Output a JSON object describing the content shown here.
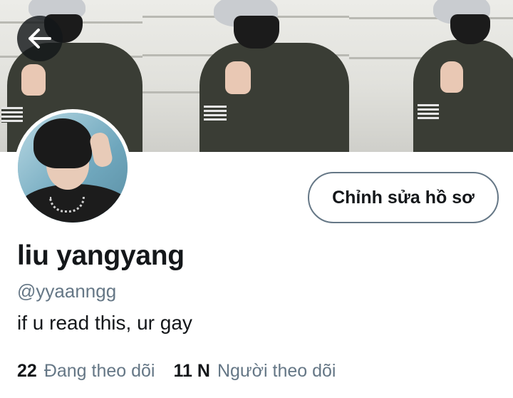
{
  "profile": {
    "display_name": "liu yangyang",
    "handle": "@yyaanngg",
    "bio": "if u read this, ur gay",
    "edit_button_label": "Chỉnh sửa hồ sơ",
    "stats": {
      "following": {
        "count": "22",
        "label": "Đang theo dõi"
      },
      "followers": {
        "count": "11 N",
        "label": "Người theo dõi"
      }
    }
  },
  "icons": {
    "back": "arrow-left-icon"
  },
  "colors": {
    "primary_text": "#14171a",
    "secondary_text": "#657786",
    "button_border": "#657786",
    "back_button_bg": "#14171a",
    "background": "#ffffff"
  }
}
